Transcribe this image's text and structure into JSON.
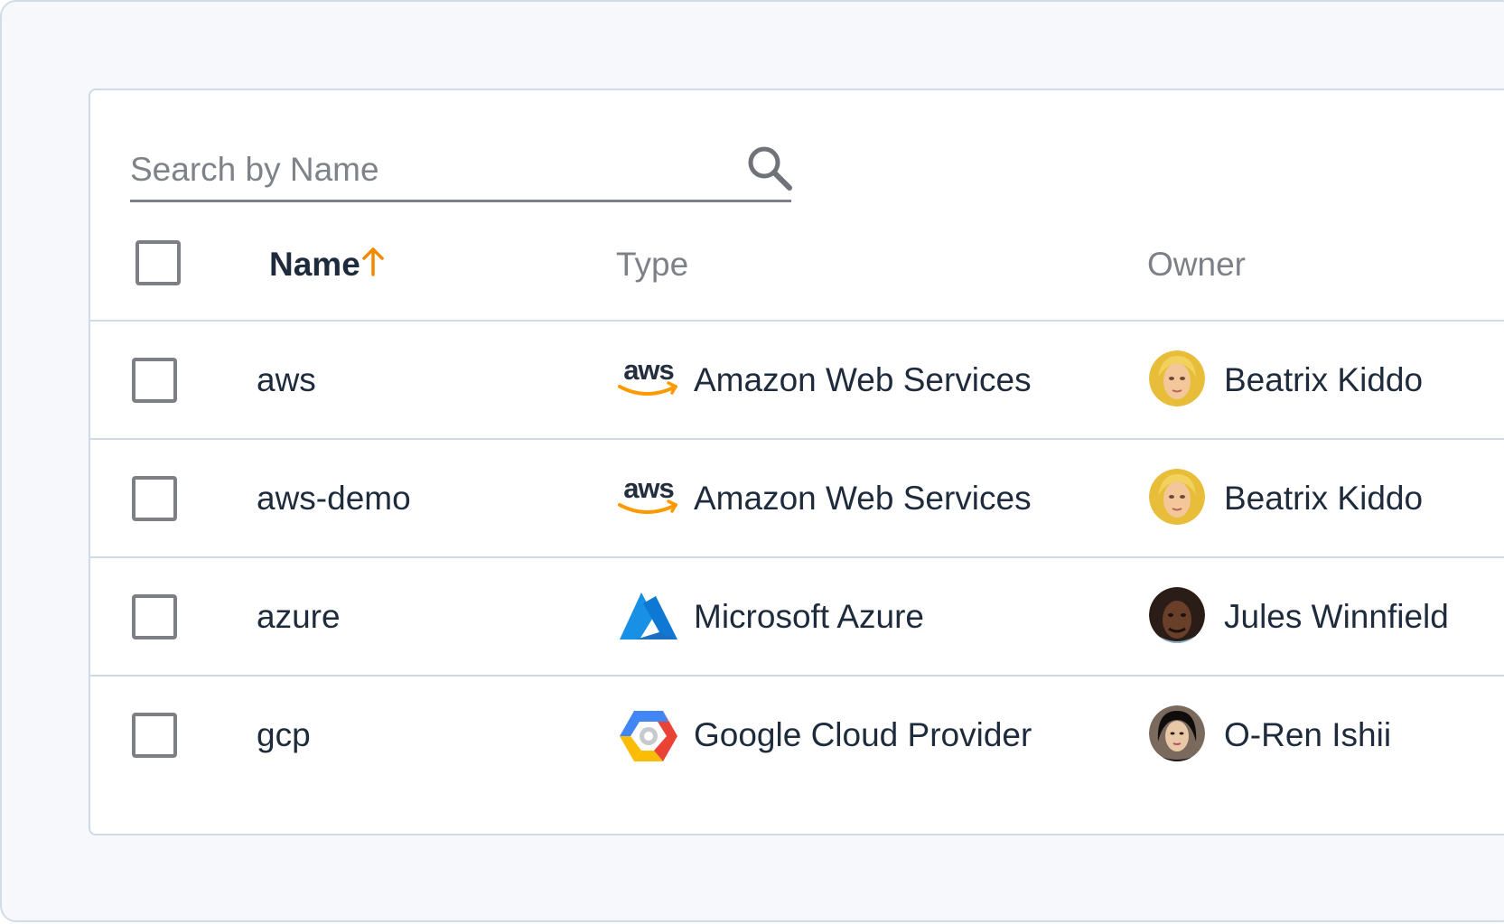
{
  "search": {
    "placeholder": "Search by Name",
    "value": ""
  },
  "table": {
    "columns": {
      "name": "Name",
      "type": "Type",
      "owner": "Owner"
    },
    "sort": {
      "column": "name",
      "direction": "ascending"
    },
    "rows": [
      {
        "name": "aws",
        "type": "Amazon Web Services",
        "type_icon": "aws-logo-icon",
        "owner": "Beatrix Kiddo",
        "checked": false
      },
      {
        "name": "aws-demo",
        "type": "Amazon Web Services",
        "type_icon": "aws-logo-icon",
        "owner": "Beatrix Kiddo",
        "checked": false
      },
      {
        "name": "azure",
        "type": "Microsoft Azure",
        "type_icon": "azure-logo-icon",
        "owner": "Jules Winnfield",
        "checked": false
      },
      {
        "name": "gcp",
        "type": "Google Cloud Provider",
        "type_icon": "gcp-logo-icon",
        "owner": "O-Ren Ishii",
        "checked": false
      }
    ]
  },
  "colors": {
    "text": "#1e2b3c",
    "muted": "#7d8187",
    "sort_accent": "#f08a00",
    "aws_orange": "#ff9900",
    "azure_blue": "#0f78d4",
    "border": "#d0d9e7"
  }
}
